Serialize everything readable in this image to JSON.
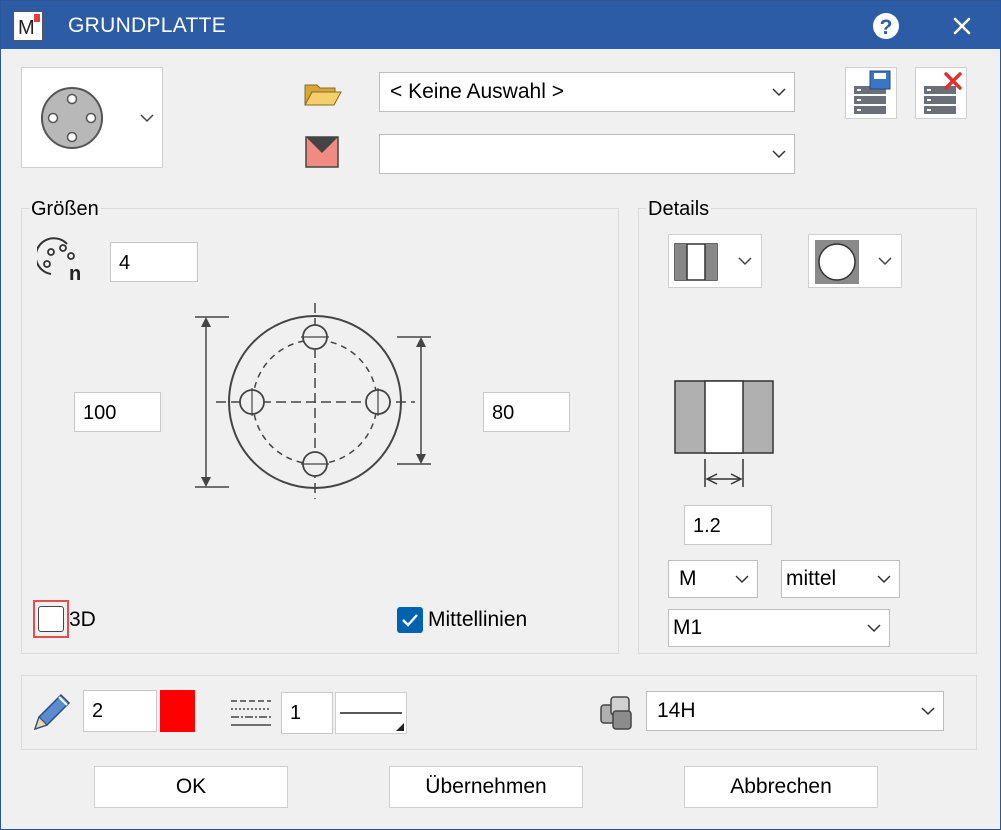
{
  "window": {
    "title": "GRUNDPLATTE"
  },
  "top": {
    "selection_value": "< Keine Auswahl >",
    "second_value": ""
  },
  "groessen": {
    "label": "Größen",
    "count_value": "4",
    "diameter_value": "100",
    "circle_value": "80",
    "threed_label": "3D",
    "threed_checked": false,
    "centerlines_label": "Mittellinien",
    "centerlines_checked": true
  },
  "details": {
    "label": "Details",
    "thickness_value": "1.2",
    "m_value": "M",
    "quality_value": "mittel",
    "m1_value": "M1"
  },
  "bottom": {
    "pen_value": "2",
    "pen_color": "#ff0000",
    "line_value": "1",
    "layer_value": "14H"
  },
  "buttons": {
    "ok": "OK",
    "apply": "Übernehmen",
    "cancel": "Abbrechen"
  },
  "colors": {
    "titlebar": "#2d5ca6",
    "accent": "#0063b1",
    "focus_border": "#e05050"
  }
}
